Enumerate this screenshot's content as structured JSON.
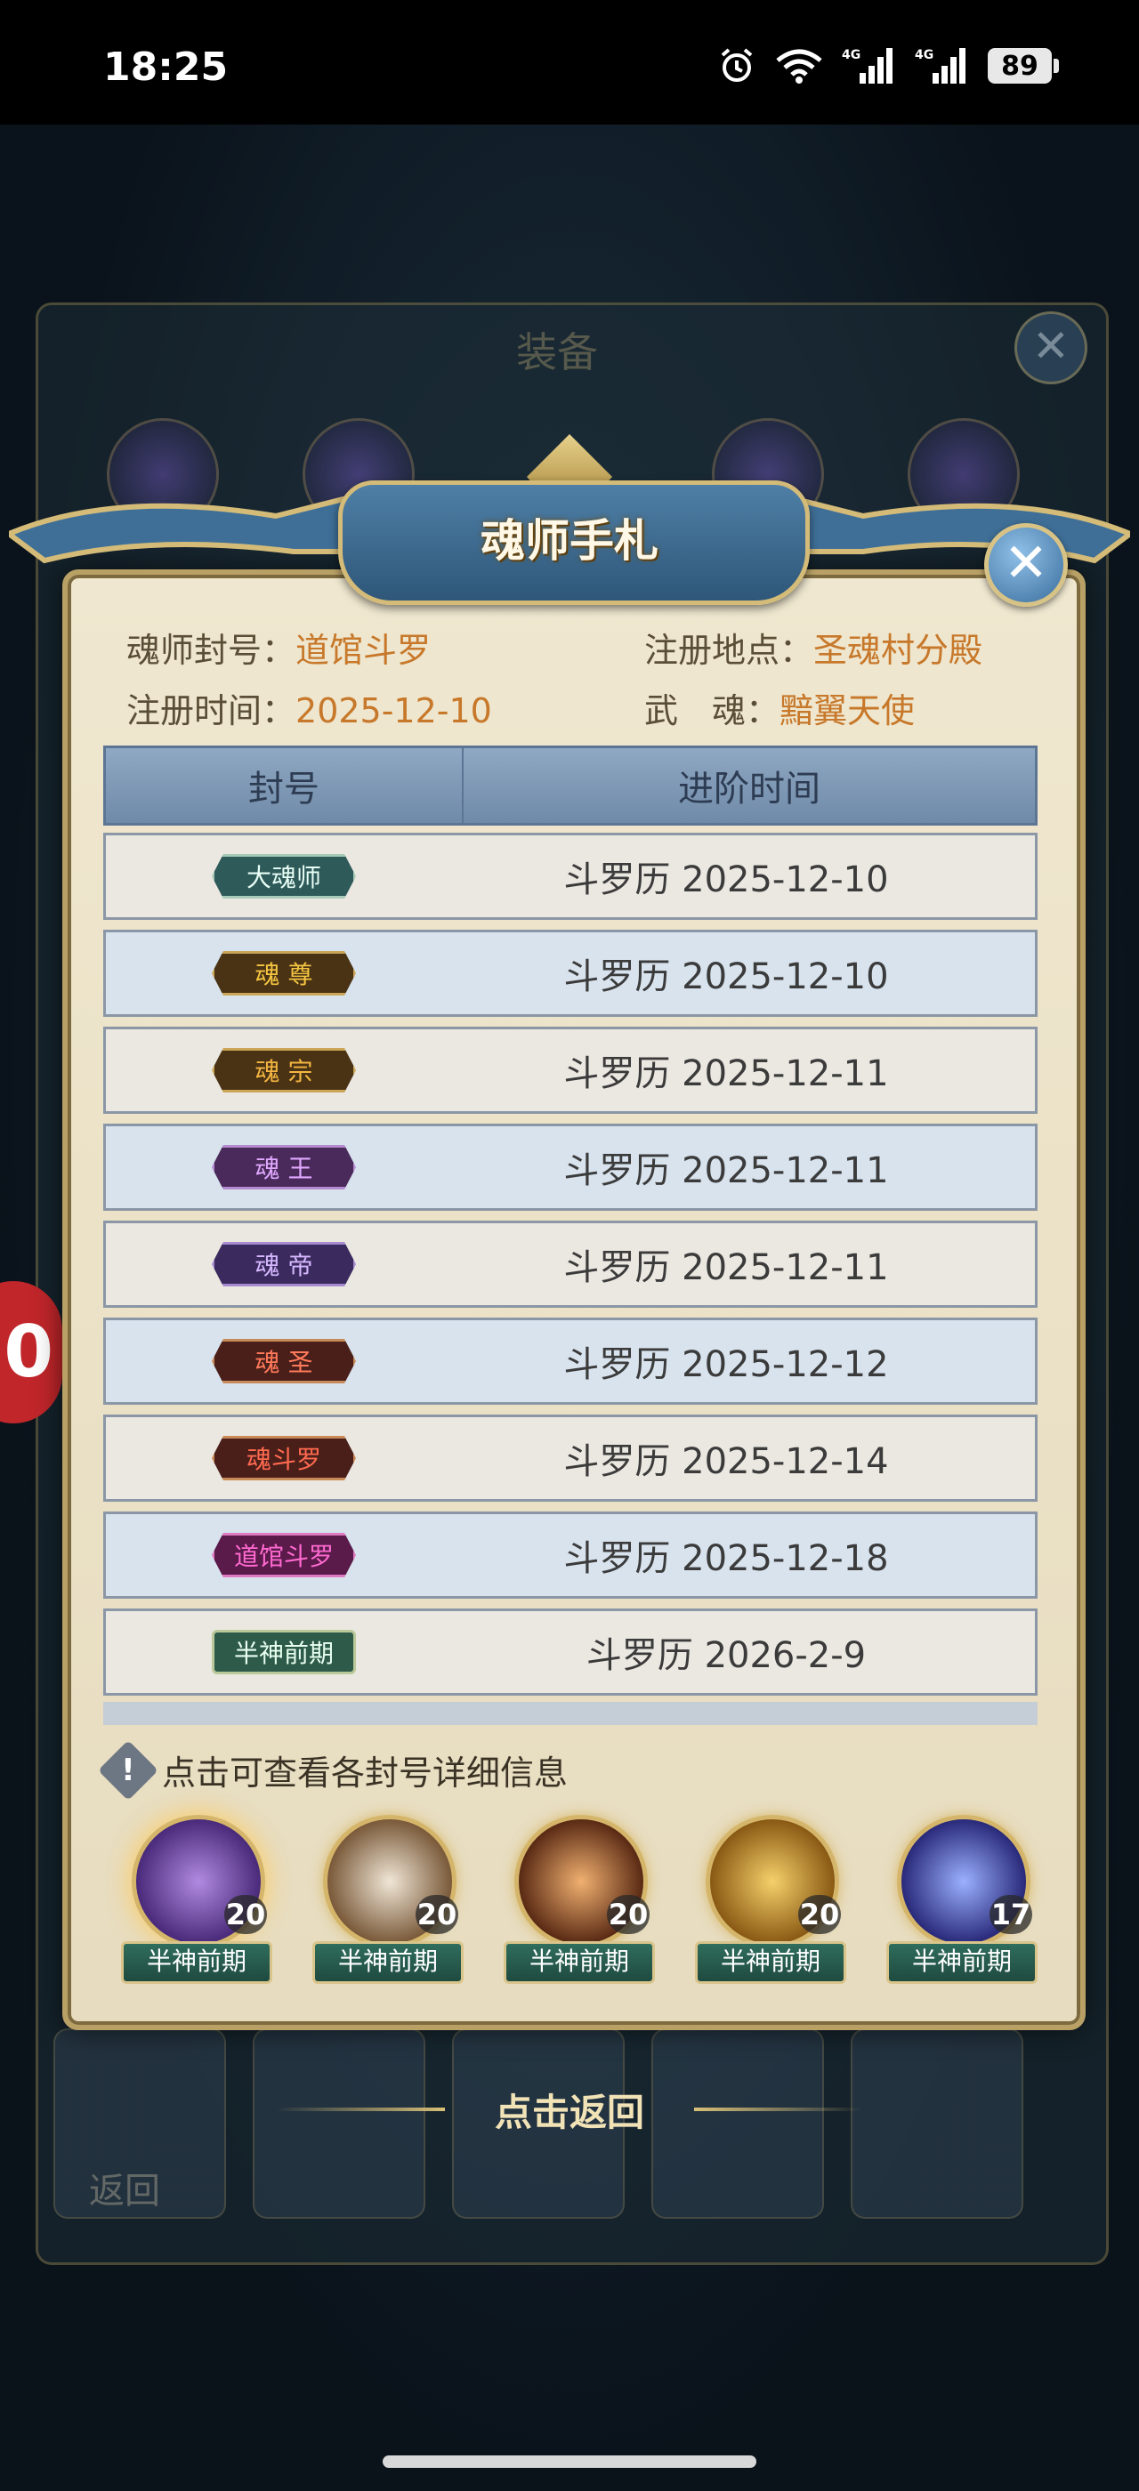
{
  "status_bar": {
    "time": "18:25",
    "battery": "89",
    "icons": [
      "alarm-icon",
      "wifi-icon",
      "signal-4g-icon",
      "signal-4g-icon"
    ]
  },
  "background": {
    "panel_title": "装备",
    "side_badge": "0",
    "back_label": "返回"
  },
  "dialog": {
    "title": "魂师手札",
    "close": "✕",
    "info": {
      "title_label": "魂师封号：",
      "title_value": "道馆斗罗",
      "place_label": "注册地点：",
      "place_value": "圣魂村分殿",
      "date_label": "注册时间：",
      "date_value": "2025-12-10",
      "soul_label": "武　魂：",
      "soul_value": "黯翼天使"
    },
    "table": {
      "headers": [
        "封号",
        "进阶时间"
      ],
      "rows": [
        {
          "rank": "大魂师",
          "date": "斗罗历 2025-12-10"
        },
        {
          "rank": "魂 尊",
          "date": "斗罗历 2025-12-10"
        },
        {
          "rank": "魂 宗",
          "date": "斗罗历 2025-12-11"
        },
        {
          "rank": "魂 王",
          "date": "斗罗历 2025-12-11"
        },
        {
          "rank": "魂 帝",
          "date": "斗罗历 2025-12-11"
        },
        {
          "rank": "魂 圣",
          "date": "斗罗历 2025-12-12"
        },
        {
          "rank": "魂斗罗",
          "date": "斗罗历 2025-12-14"
        },
        {
          "rank": "道馆斗罗",
          "date": "斗罗历 2025-12-18"
        },
        {
          "rank": "半神前期",
          "date": "斗罗历 2026-2-9"
        }
      ]
    },
    "hint": "点击可查看各封号详细信息",
    "portraits": [
      {
        "level": "20",
        "tag": "半神前期"
      },
      {
        "level": "20",
        "tag": "半神前期"
      },
      {
        "level": "20",
        "tag": "半神前期"
      },
      {
        "level": "20",
        "tag": "半神前期"
      },
      {
        "level": "17",
        "tag": "半神前期"
      }
    ]
  },
  "back_button": "点击返回",
  "colors": {
    "accent_gold": "#c7782a",
    "panel_bg": "#efe7cf",
    "header_blue": "#6f8aa8"
  }
}
